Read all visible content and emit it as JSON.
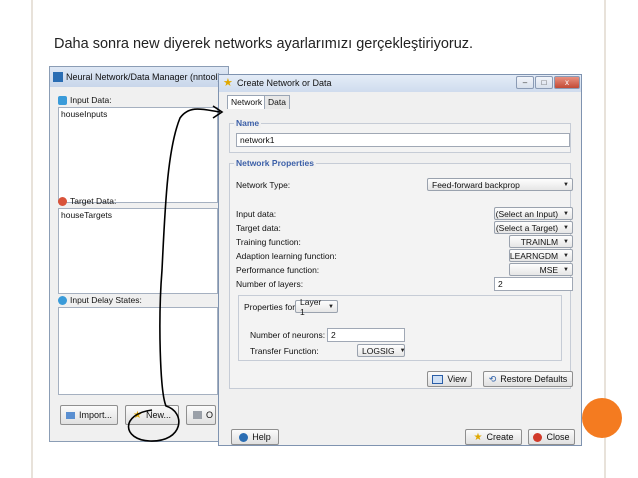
{
  "slide": {
    "heading": "Daha sonra new diyerek networks ayarlarımızı gerçekleştiriyoruz."
  },
  "nntool": {
    "title": "Neural Network/Data Manager (nntool)",
    "input_data_label": "Input Data:",
    "input_items": [
      "houseInputs"
    ],
    "target_data_label": "Target Data:",
    "target_items": [
      "houseTargets"
    ],
    "input_delay_label": "Input Delay States:",
    "import_button": "Import...",
    "new_button": "New...",
    "open_button_partial": "O"
  },
  "dialog": {
    "title": "Create Network or Data",
    "tabs": [
      "Network",
      "Data"
    ],
    "name_section": "Name",
    "name_value": "network1",
    "props_section": "Network Properties",
    "network_type_label": "Network Type:",
    "network_type_value": "Feed-forward backprop",
    "input_data_label": "Input data:",
    "input_data_value": "(Select an Input)",
    "target_data_label": "Target data:",
    "target_data_value": "(Select a Target)",
    "training_fn_label": "Training function:",
    "training_fn_value": "TRAINLM",
    "adaption_fn_label": "Adaption learning function:",
    "adaption_fn_value": "LEARNGDM",
    "performance_fn_label": "Performance function:",
    "performance_fn_value": "MSE",
    "num_layers_label": "Number of layers:",
    "num_layers_value": "2",
    "properties_for_label": "Properties for:",
    "properties_for_value": "Layer 1",
    "num_neurons_label": "Number of neurons:",
    "num_neurons_value": "2",
    "transfer_fn_label": "Transfer Function:",
    "transfer_fn_value": "LOGSIG",
    "view_button": "View",
    "restore_button": "Restore Defaults",
    "help_button": "Help",
    "create_button": "Create",
    "close_button": "Close",
    "window_buttons": [
      "–",
      "□",
      "x"
    ]
  },
  "colors": {
    "accent_orange": "#f47b20",
    "section_blue": "#3b5fa8",
    "annotation_line": "#000000"
  }
}
